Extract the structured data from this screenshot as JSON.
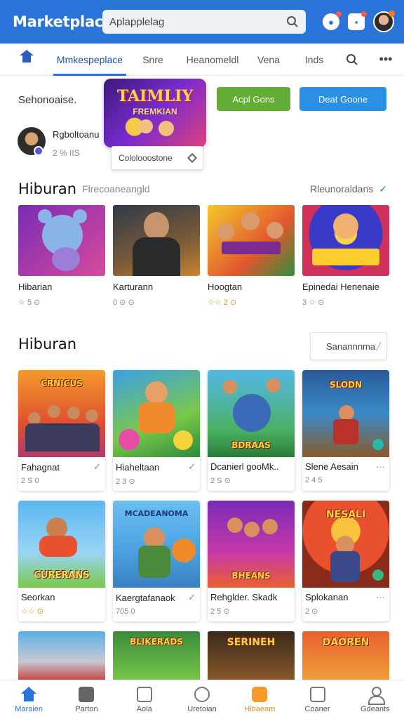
{
  "app": {
    "title": "Marketplace",
    "search_placeholder": "Aplapplelag"
  },
  "tabs": [
    {
      "label": "Mmkespeplace",
      "active": true
    },
    {
      "label": "Snre"
    },
    {
      "label": "Heanomeldl"
    },
    {
      "label": "Vena"
    },
    {
      "label": "Inds"
    }
  ],
  "hero": {
    "label": "Sehonoaise.",
    "promo_title": "TAIMLIY",
    "promo_subtitle": "FREMKIAN",
    "promo_card_label": "Cololooostone",
    "button_green": "Acpl Gons",
    "button_blue": "Deat Goone",
    "user_name": "Rgboltoanu",
    "user_meta": "2 % IIS"
  },
  "section1": {
    "title": "Hiburan",
    "subtitle": "Flrecoaneangld",
    "link": "Rleunoraldans",
    "items": [
      {
        "name": "Hibarian",
        "meta": "☆ 5 ⊙"
      },
      {
        "name": "Karturann",
        "meta": "0 ⊙ ⊙"
      },
      {
        "name": "Hoogtan",
        "meta": "☆☆ 2 ⊙"
      },
      {
        "name": "Epinedai Henenaie",
        "meta": "3 ☆ ⊙"
      }
    ]
  },
  "section2": {
    "title": "Hiburan",
    "dropdown_value": "Sanannnma",
    "items": [
      {
        "name": "Fahagnat",
        "meta": "2 S 0",
        "thumb_text": "CRNICUS",
        "action": "✓"
      },
      {
        "name": "Hiaheltaan",
        "meta": "2 3 ⊙",
        "thumb_text": "",
        "action": "✓"
      },
      {
        "name": "Dcanierl gooMk..",
        "meta": "2 S ⊙",
        "thumb_text": "BDRAAS",
        "action": ""
      },
      {
        "name": "Slene Aesain",
        "meta": "2 4 5",
        "thumb_text": "SLODN",
        "action": "···"
      },
      {
        "name": "Seorkan",
        "meta": "☆☆ ⊙",
        "thumb_text": "CURERANS",
        "action": ""
      },
      {
        "name": "Kaergtafanaok",
        "meta": "705 0",
        "thumb_text": "MCADEANOMA",
        "action": "✓"
      },
      {
        "name": "Rehglder. Skadk",
        "meta": "2 5 ⊙",
        "thumb_text": "BHEANS",
        "action": ""
      },
      {
        "name": "Splokanan",
        "meta": "2 ⊙",
        "thumb_text": "NESALI",
        "action": "···"
      }
    ],
    "partial_items": [
      {
        "thumb_text": ""
      },
      {
        "thumb_text": "BLIKERADS"
      },
      {
        "thumb_text": "SERINEH"
      },
      {
        "thumb_text": "DAOREN"
      }
    ]
  },
  "bottom_nav": [
    {
      "label": "Maraien",
      "icon": "home-icon",
      "state": "active"
    },
    {
      "label": "Parton",
      "icon": "bag-icon"
    },
    {
      "label": "Aola",
      "icon": "grid-icon"
    },
    {
      "label": "Uretoian",
      "icon": "chat-icon"
    },
    {
      "label": "Hibaeam",
      "icon": "star-icon",
      "state": "highlight"
    },
    {
      "label": "Coaner",
      "icon": "calendar-icon"
    },
    {
      "label": "Gdeants",
      "icon": "person-icon"
    }
  ],
  "colors": {
    "brand_blue": "#2a73d9",
    "button_green": "#62ad35",
    "button_blue": "#2b8fe3",
    "highlight_orange": "#f79a28"
  }
}
